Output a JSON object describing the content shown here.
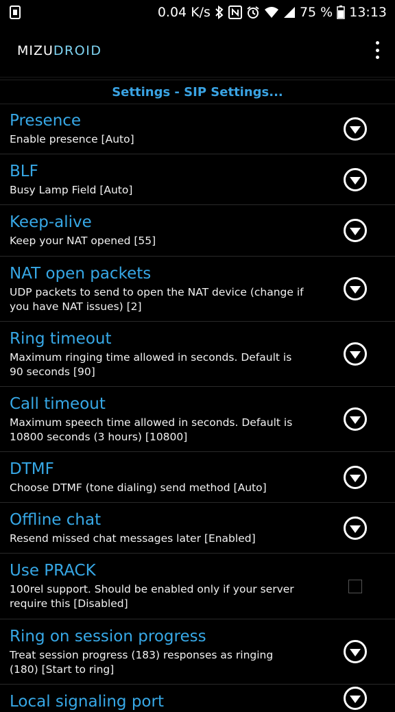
{
  "status_bar": {
    "speed": "0.04 K/s",
    "battery": "75 %",
    "time": "13:13"
  },
  "app": {
    "logo_part1": "MIZU",
    "logo_part2": "DROID"
  },
  "header": {
    "title": "Settings - SIP Settings..."
  },
  "settings": [
    {
      "title": "Presence",
      "subtitle": "Enable presence [Auto]",
      "control": "dropdown"
    },
    {
      "title": "BLF",
      "subtitle": "Busy Lamp Field [Auto]",
      "control": "dropdown"
    },
    {
      "title": "Keep-alive",
      "subtitle": "Keep your NAT opened [55]",
      "control": "dropdown"
    },
    {
      "title": "NAT open packets",
      "subtitle": "UDP packets to send to open the NAT device (change if you have NAT issues) [2]",
      "control": "dropdown"
    },
    {
      "title": "Ring timeout",
      "subtitle": "Maximum ringing time allowed in seconds. Default is 90 seconds [90]",
      "control": "dropdown"
    },
    {
      "title": "Call timeout",
      "subtitle": "Maximum speech time allowed in seconds. Default is 10800 seconds (3 hours) [10800]",
      "control": "dropdown"
    },
    {
      "title": "DTMF",
      "subtitle": "Choose DTMF (tone dialing) send method [Auto]",
      "control": "dropdown"
    },
    {
      "title": "Offline chat",
      "subtitle": "Resend missed chat messages later [Enabled]",
      "control": "dropdown"
    },
    {
      "title": "Use PRACK",
      "subtitle": "100rel support. Should be enabled only if your server require this [Disabled]",
      "control": "checkbox"
    },
    {
      "title": "Ring on session progress",
      "subtitle": "Treat session progress (183) responses as ringing (180) [Start to ring]",
      "control": "dropdown"
    },
    {
      "title": "Local signaling port",
      "subtitle": "",
      "control": "dropdown"
    }
  ],
  "icons": {
    "dropdown": "chevron-down-circle-icon",
    "overflow": "overflow-menu-icon"
  },
  "colors": {
    "accent": "#37a8e6",
    "header": "#3aa3e3",
    "background": "#000000"
  }
}
